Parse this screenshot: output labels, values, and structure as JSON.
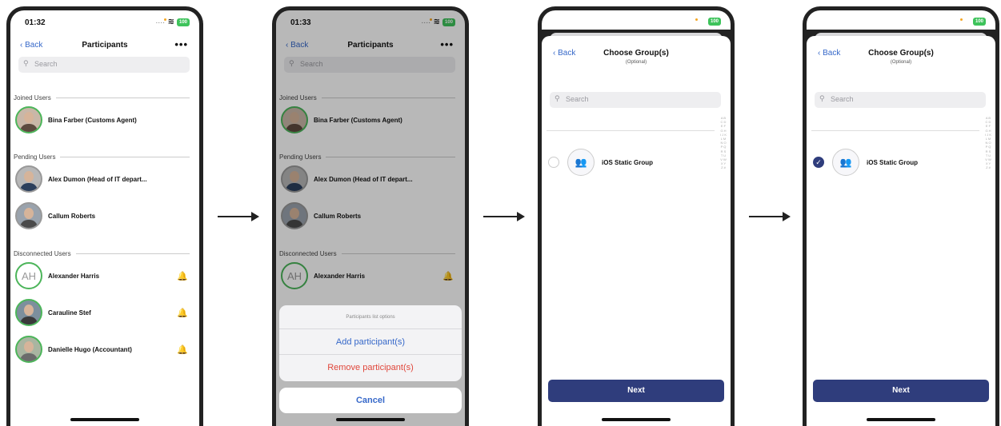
{
  "screen1": {
    "time": "01:32",
    "battery": "100",
    "back": "Back",
    "title": "Participants",
    "more": "•••",
    "search_placeholder": "Search",
    "sections": {
      "joined": "Joined Users",
      "pending": "Pending Users",
      "disconnected": "Disconnected Users"
    },
    "joined": [
      {
        "name": "Bina  Farber (Customs Agent)"
      }
    ],
    "pending": [
      {
        "name": "Alex Dumon  (Head of IT depart..."
      },
      {
        "name": "Callum Roberts"
      }
    ],
    "disconnected": [
      {
        "name": "Alexander Harris",
        "initials": "AH"
      },
      {
        "name": "Carauline Stef"
      },
      {
        "name": "Danielle Hugo  (Accountant)"
      }
    ]
  },
  "screen2": {
    "time": "01:33",
    "battery": "100",
    "back": "Back",
    "title": "Participants",
    "more": "•••",
    "search_placeholder": "Search",
    "sections": {
      "joined": "Joined Users",
      "pending": "Pending Users",
      "disconnected": "Disconnected Users"
    },
    "joined_name": "Bina  Farber (Customs Agent)",
    "pending_names": [
      "Alex Dumon  (Head of IT depart...",
      "Callum Roberts"
    ],
    "disconnected_name": "Alexander Harris",
    "disconnected_initials": "AH",
    "sheet": {
      "header": "Participants list options",
      "add": "Add participant(s)",
      "remove": "Remove participant(s)",
      "cancel": "Cancel"
    }
  },
  "screen3": {
    "battery": "100",
    "back": "Back",
    "title": "Choose Group(s)",
    "subtitle": "(Optional)",
    "search_placeholder": "Search",
    "group_name": "iOS Static Group",
    "next": "Next",
    "index_letters": "A B C D E F G H I J K L M N O P Q R S T U V W X Y Z #"
  },
  "screen4": {
    "battery": "100",
    "back": "Back",
    "title": "Choose Group(s)",
    "subtitle": "(Optional)",
    "search_placeholder": "Search",
    "group_name": "iOS Static Group",
    "next": "Next",
    "index_letters": "A B C D E F G H I J K L M N O P Q R S T U V W X Y Z #"
  },
  "icons": {
    "back": "‹",
    "search": "⚲",
    "bell": "🔔",
    "wifi": "≋",
    "group": "👥",
    "check": "✓"
  },
  "colors": {
    "accent": "#3668c9",
    "primary_button": "#2f3d7c",
    "destructive": "#e0473b",
    "online_ring": "#4cb55a"
  }
}
